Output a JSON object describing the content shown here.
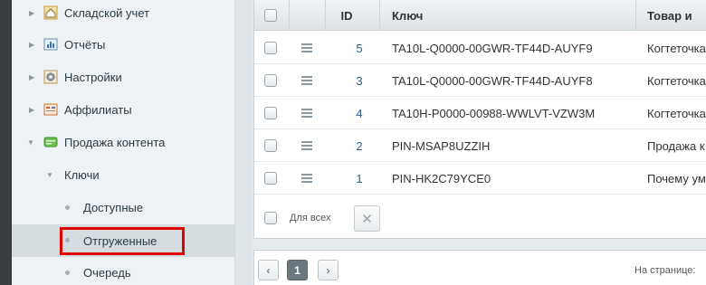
{
  "sidebar": {
    "items": [
      {
        "label": "Складской учет",
        "icon": "warehouse-icon"
      },
      {
        "label": "Отчёты",
        "icon": "reports-icon"
      },
      {
        "label": "Настройки",
        "icon": "settings-icon"
      },
      {
        "label": "Аффилиаты",
        "icon": "affiliates-icon"
      },
      {
        "label": "Продажа контента",
        "icon": "content-sale-icon"
      },
      {
        "label": "Ключи"
      },
      {
        "label": "Доступные"
      },
      {
        "label": "Отгруженные"
      },
      {
        "label": "Очередь"
      }
    ]
  },
  "table": {
    "headers": {
      "id": "ID",
      "key": "Ключ",
      "product": "Товар и"
    },
    "rows": [
      {
        "id": "5",
        "key": "TA10L-Q0000-00GWR-TF44D-AUYF9",
        "product": "Когтеточка"
      },
      {
        "id": "3",
        "key": "TA10L-Q0000-00GWR-TF44D-AUYF8",
        "product": "Когтеточка"
      },
      {
        "id": "4",
        "key": "TA10H-P0000-00988-WWLVT-VZW3M",
        "product": "Когтеточка"
      },
      {
        "id": "2",
        "key": "PIN-MSAP8UZZIH",
        "product": "Продажа к"
      },
      {
        "id": "1",
        "key": "PIN-HK2C79YCE0",
        "product": "Почему ум"
      }
    ],
    "for_all_label": "Для всех",
    "clear_icon": "✕"
  },
  "pager": {
    "prev": "‹",
    "current_page": "1",
    "next": "›",
    "per_page_label": "На странице:"
  },
  "colors": {
    "highlight": "#e00000",
    "link": "#2f5a8c"
  }
}
